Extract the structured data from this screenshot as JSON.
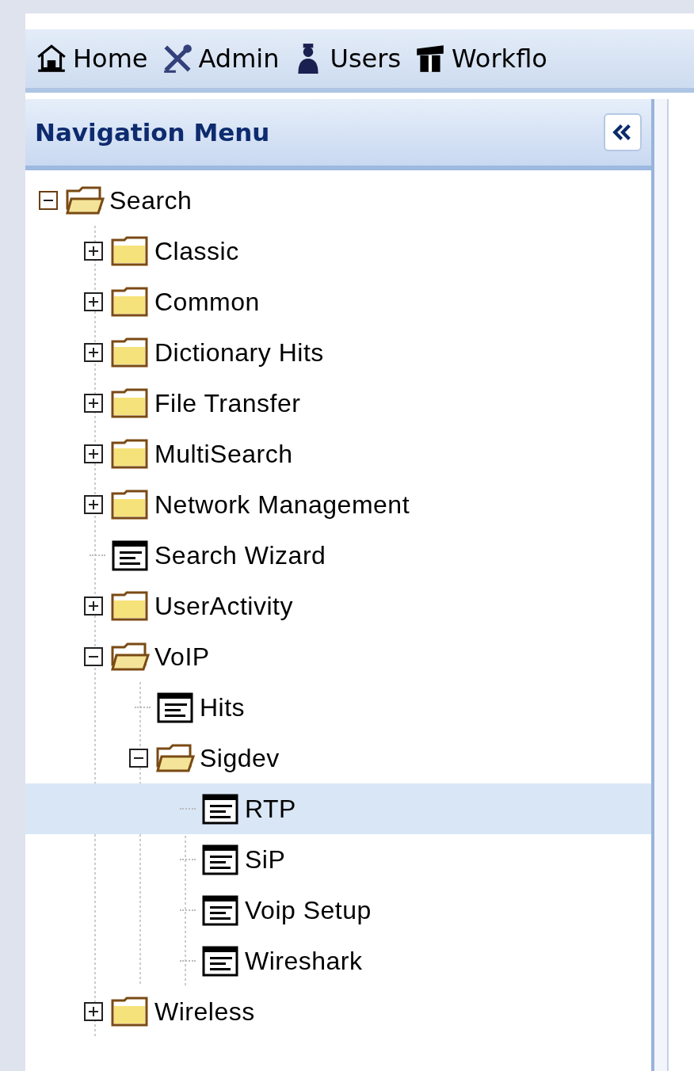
{
  "toolbar": [
    {
      "label": "Home",
      "kind": "home"
    },
    {
      "label": "Admin",
      "kind": "admin"
    },
    {
      "label": "Users",
      "kind": "users"
    },
    {
      "label": "Workflo",
      "kind": "workflow"
    }
  ],
  "navigation": {
    "title": "Navigation Menu",
    "tree": [
      {
        "label": "Search",
        "kind": "folder",
        "expanded": true,
        "selected": false,
        "children": [
          {
            "label": "Classic",
            "kind": "folder",
            "expanded": false,
            "selected": false
          },
          {
            "label": "Common",
            "kind": "folder",
            "expanded": false,
            "selected": false
          },
          {
            "label": "Dictionary Hits",
            "kind": "folder",
            "expanded": false,
            "selected": false
          },
          {
            "label": "File Transfer",
            "kind": "folder",
            "expanded": false,
            "selected": false
          },
          {
            "label": "MultiSearch",
            "kind": "folder",
            "expanded": false,
            "selected": false
          },
          {
            "label": "Network Management",
            "kind": "folder",
            "expanded": false,
            "selected": false
          },
          {
            "label": "Search Wizard",
            "kind": "page",
            "selected": false
          },
          {
            "label": "UserActivity",
            "kind": "folder",
            "expanded": false,
            "selected": false
          },
          {
            "label": "VoIP",
            "kind": "folder",
            "expanded": true,
            "selected": false,
            "children": [
              {
                "label": "Hits",
                "kind": "page",
                "selected": false
              },
              {
                "label": "Sigdev",
                "kind": "folder",
                "expanded": true,
                "selected": false,
                "children": [
                  {
                    "label": "RTP",
                    "kind": "page",
                    "selected": true
                  },
                  {
                    "label": "SiP",
                    "kind": "page",
                    "selected": false
                  },
                  {
                    "label": "Voip Setup",
                    "kind": "page",
                    "selected": false
                  },
                  {
                    "label": "Wireshark",
                    "kind": "page",
                    "selected": false
                  }
                ]
              }
            ]
          },
          {
            "label": "Wireless",
            "kind": "folder",
            "expanded": false,
            "selected": false
          }
        ]
      }
    ]
  }
}
